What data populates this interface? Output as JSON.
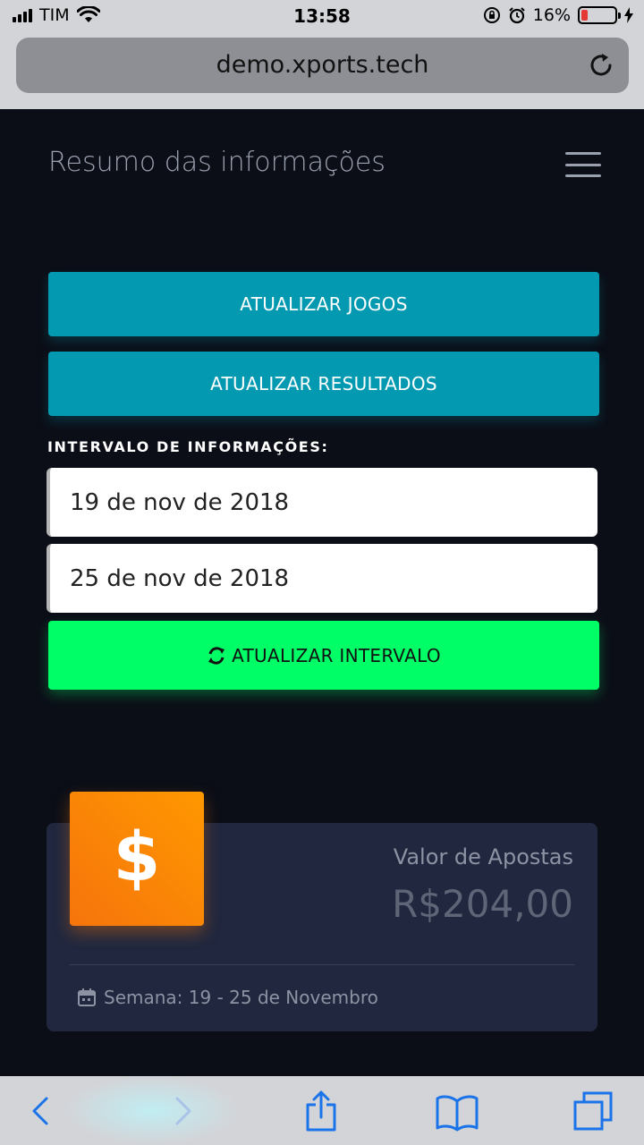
{
  "status_bar": {
    "carrier": "TIM",
    "time": "13:58",
    "battery": "16%",
    "battery_level": 0.16
  },
  "browser": {
    "url": "demo.xports.tech"
  },
  "header": {
    "title": "Resumo das informações"
  },
  "actions": {
    "update_games": "ATUALIZAR JOGOS",
    "update_results": "ATUALIZAR RESULTADOS"
  },
  "interval": {
    "label": "INTERVALO DE INFORMAÇÕES:",
    "start_date": "19 de nov de 2018",
    "end_date": "25 de nov de 2018",
    "update_label": "ATUALIZAR INTERVALO"
  },
  "stat_card": {
    "icon_symbol": "$",
    "category": "Valor de Apostas",
    "value": "R$204,00",
    "footer": "Semana: 19 - 25 de Novembro"
  },
  "colors": {
    "background": "#0b0e17",
    "cyan_button": "#0399b1",
    "green_button": "#00ff66",
    "card": "#20273e",
    "icon_orange": "#ff9800"
  },
  "icons": [
    "wifi-icon",
    "lock-rotation-icon",
    "alarm-icon",
    "reload-icon",
    "menu-icon",
    "refresh-icon",
    "calendar-icon",
    "back-icon",
    "forward-icon",
    "share-icon",
    "bookmarks-icon",
    "tabs-icon"
  ]
}
